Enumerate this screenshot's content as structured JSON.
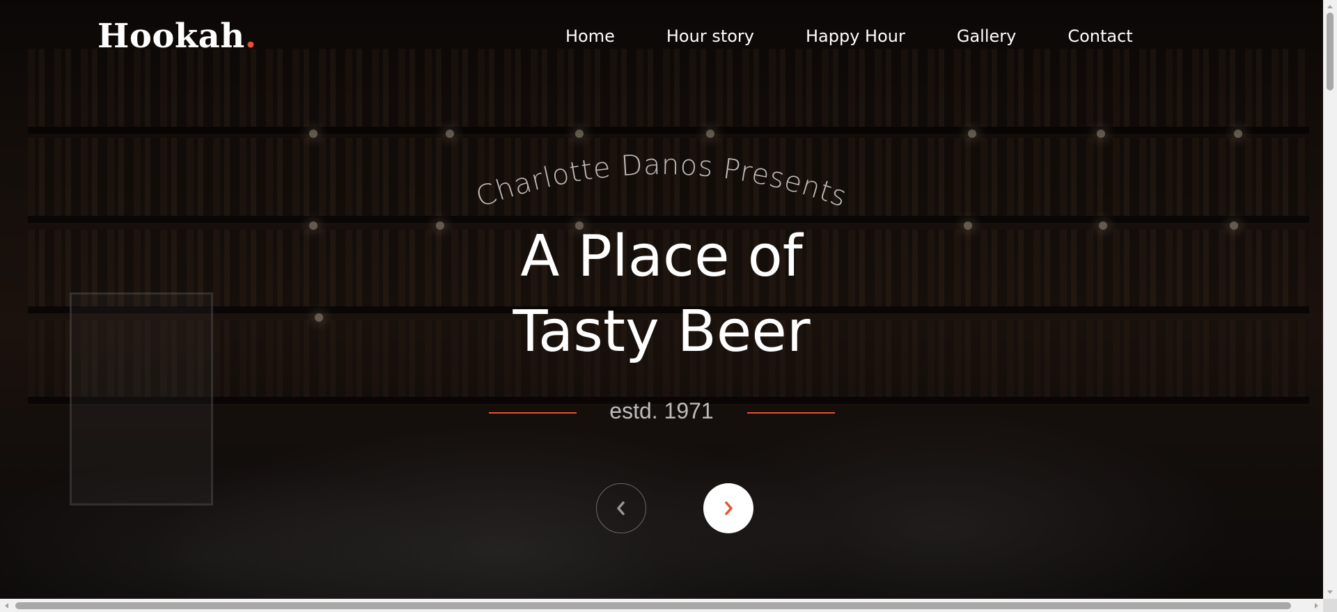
{
  "brand": {
    "name": "Hookah",
    "dot": ".",
    "accent_color": "#e8512f"
  },
  "nav": {
    "items": [
      {
        "label": "Home"
      },
      {
        "label": "Hour story"
      },
      {
        "label": "Happy Hour"
      },
      {
        "label": "Gallery"
      },
      {
        "label": "Contact"
      }
    ]
  },
  "hero": {
    "kicker": "Charlotte Danos Presents",
    "headline_line1": "A Place of",
    "headline_line2": "Tasty Beer",
    "established": "estd. 1971",
    "background_image": "dark-bar-shelves-with-bottles"
  },
  "carousel": {
    "prev_icon": "chevron-left-icon",
    "next_icon": "chevron-right-icon",
    "next_button_color": "#ffffff",
    "next_icon_color": "#e8512f"
  },
  "scrollbars": {
    "vertical": "visible",
    "horizontal": "visible"
  }
}
